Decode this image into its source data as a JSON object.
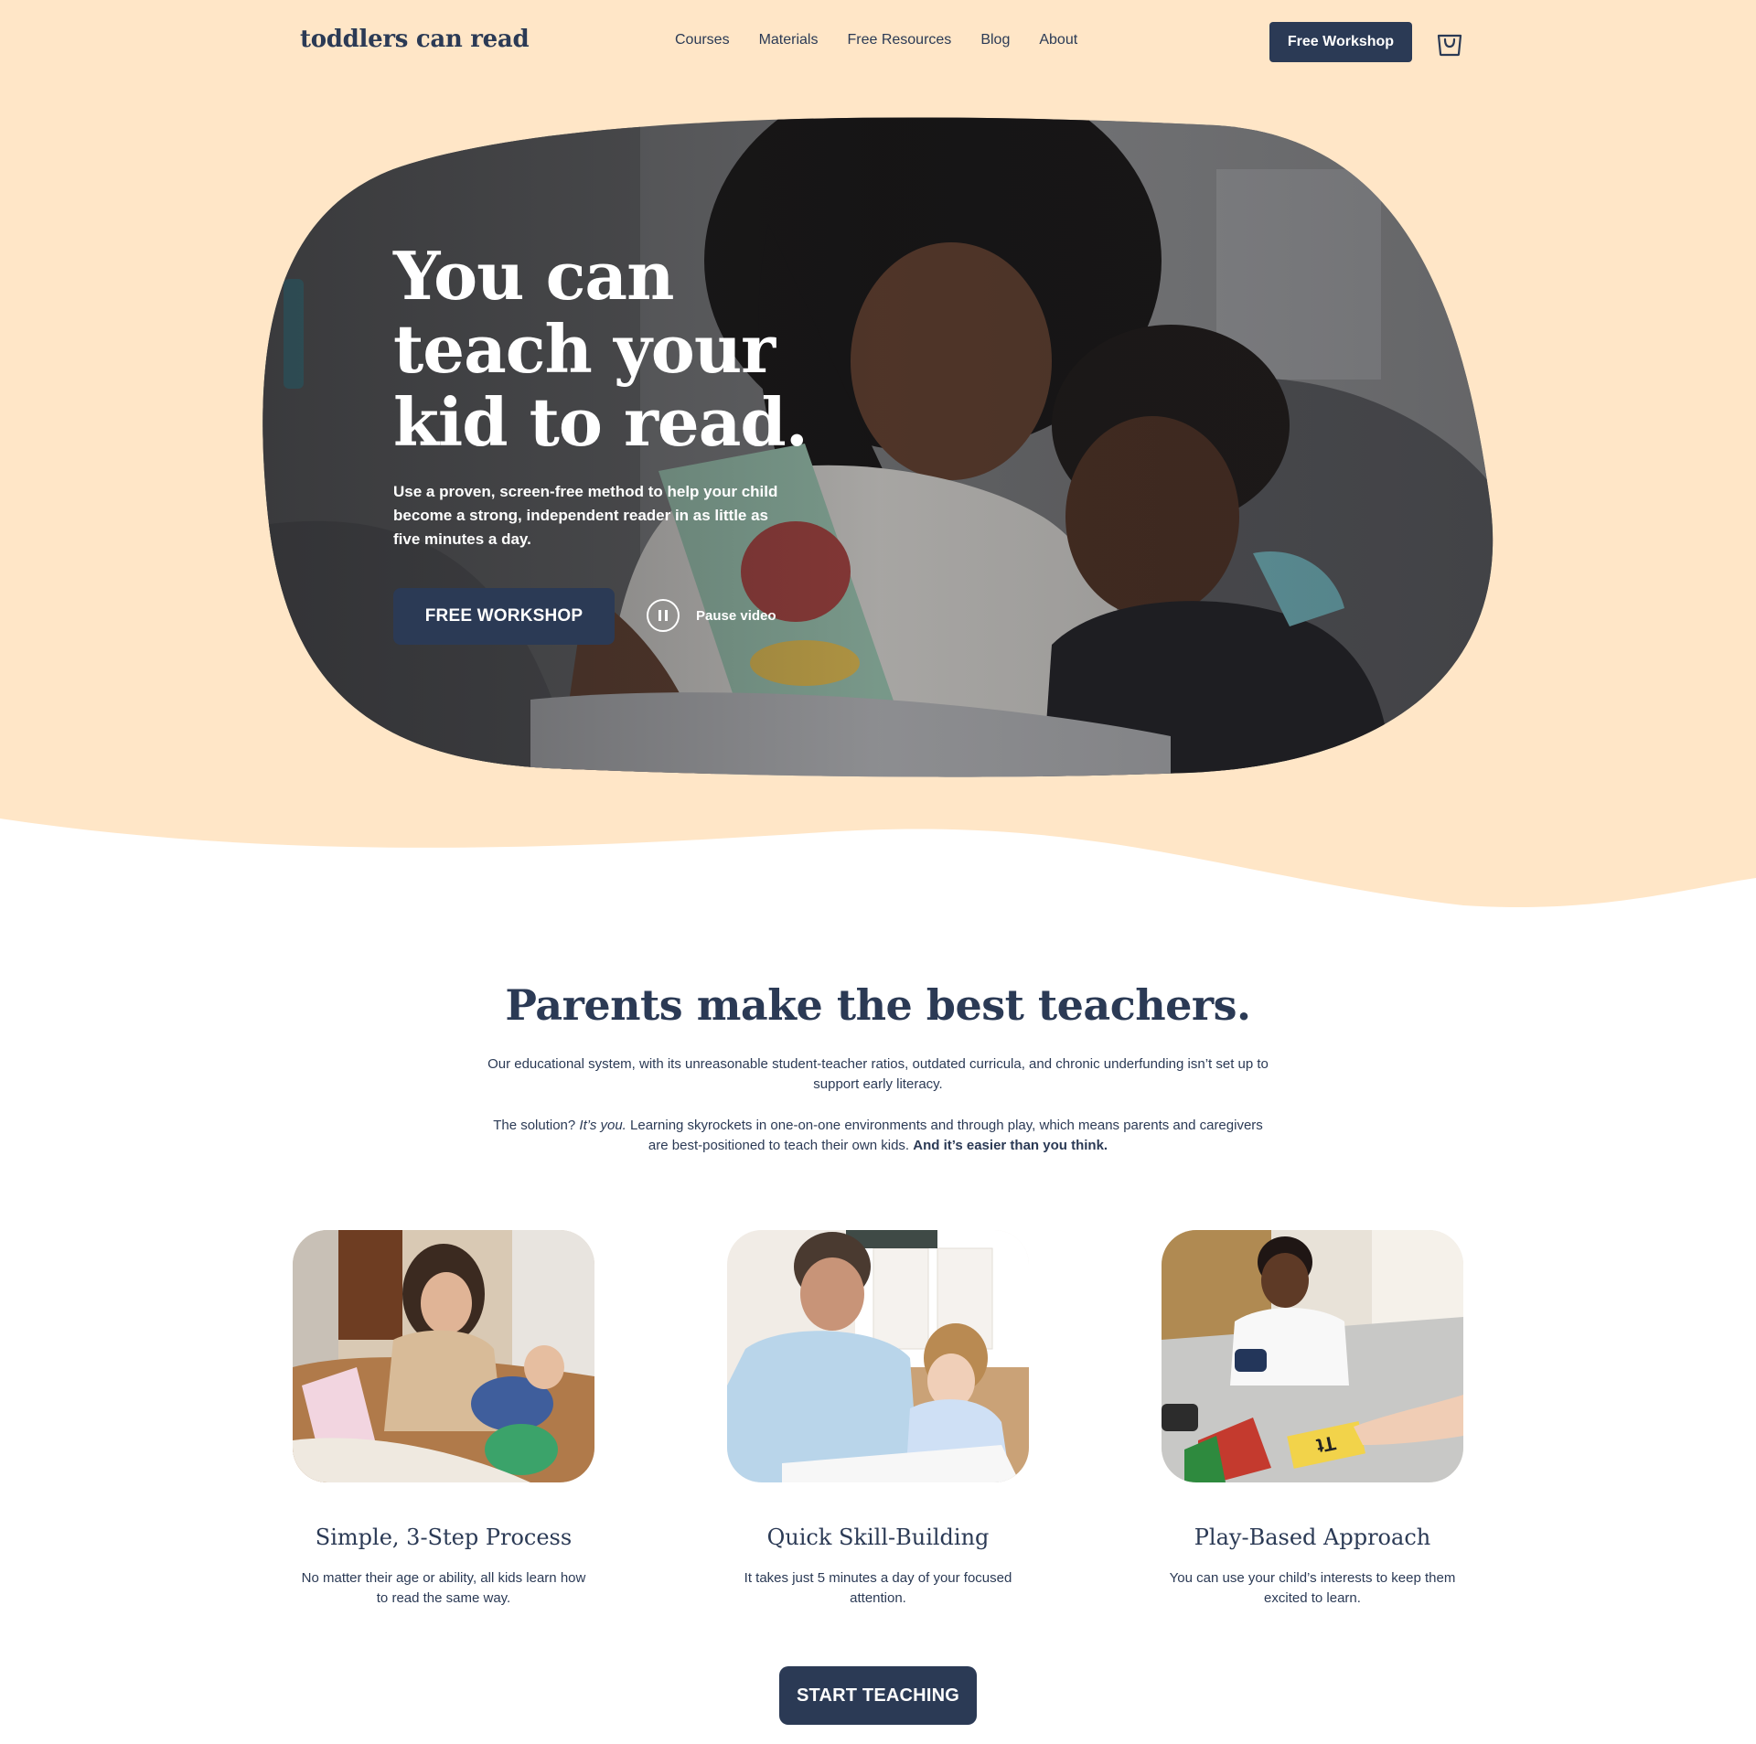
{
  "header": {
    "logo": "toddlers can read",
    "nav": [
      "Courses",
      "Materials",
      "Free Resources",
      "Blog",
      "About"
    ],
    "cta": "Free Workshop"
  },
  "hero": {
    "title": "You can teach your kid to read.",
    "subtitle": "Use a proven, screen-free method to help your child become a strong, independent reader in as little as five minutes a day.",
    "cta": "FREE WORKSHOP",
    "pause_label": "Pause video"
  },
  "section": {
    "title": "Parents make the best teachers.",
    "paragraph1": "Our educational system, with its unreasonable student-teacher ratios, outdated curricula, and chronic underfunding isn’t set up to support early literacy.",
    "p2_prefix": "The solution? ",
    "p2_italic": "It’s you.",
    "p2_middle": " Learning skyrockets in one-on-one environments and through play, which means parents and caregivers are best-positioned to teach their own kids. ",
    "p2_bold": "And it’s easier than you think."
  },
  "cards": [
    {
      "title": "Simple, 3-Step Process",
      "text": "No matter their age or ability, all kids learn how to read the same way."
    },
    {
      "title": "Quick Skill-Building",
      "text": "It takes just 5 minutes a day of your focused attention."
    },
    {
      "title": "Play-Based Approach",
      "text": "You can use your child’s interests to keep them excited to learn."
    }
  ],
  "card_flashcard_text": "Tt",
  "cta_bottom": "START TEACHING",
  "colors": {
    "background_top": "#ffe6c7",
    "primary": "#2b3a55",
    "white": "#ffffff"
  },
  "icons": [
    "cart-icon",
    "pause-icon"
  ]
}
